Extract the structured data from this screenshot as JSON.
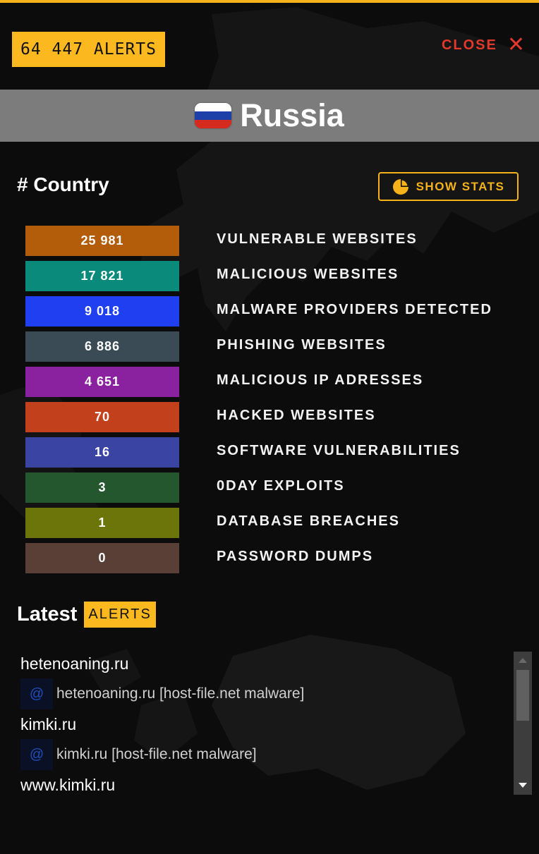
{
  "header": {
    "alerts_count_label": "64 447 ALERTS",
    "close_label": "CLOSE",
    "close_icon": "close-x-icon"
  },
  "country": {
    "name": "Russia",
    "flag_colors": [
      "#ffffff",
      "#1c3fa8",
      "#d52b1e"
    ]
  },
  "section": {
    "title": "# Country",
    "stats_button_label": "SHOW STATS",
    "stats_button_icon": "pie-chart-icon"
  },
  "stats": [
    {
      "value": "25 981",
      "label": "VULNERABLE WEBSITES",
      "color": "#b35c0a"
    },
    {
      "value": "17 821",
      "label": "MALICIOUS WEBSITES",
      "color": "#0a8a7a"
    },
    {
      "value": "9 018",
      "label": "MALWARE PROVIDERS DETECTED",
      "color": "#1f3ff0"
    },
    {
      "value": "6 886",
      "label": "PHISHING WEBSITES",
      "color": "#3a4b55"
    },
    {
      "value": "4 651",
      "label": "MALICIOUS IP ADRESSES",
      "color": "#8a22a0"
    },
    {
      "value": "70",
      "label": "HACKED WEBSITES",
      "color": "#c2401c"
    },
    {
      "value": "16",
      "label": "SOFTWARE VULNERABILITIES",
      "color": "#3a45a3"
    },
    {
      "value": "3",
      "label": "0DAY EXPLOITS",
      "color": "#24572d"
    },
    {
      "value": "1",
      "label": "DATABASE BREACHES",
      "color": "#6b750a"
    },
    {
      "value": "0",
      "label": "PASSWORD DUMPS",
      "color": "#5a3f36"
    }
  ],
  "latest": {
    "title": "Latest",
    "badge": "ALERTS",
    "items": [
      {
        "domain": "hetenoaning.ru",
        "detail": "hetenoaning.ru [host-file.net malware]"
      },
      {
        "domain": "kimki.ru",
        "detail": "kimki.ru [host-file.net malware]"
      },
      {
        "domain": "www.kimki.ru"
      }
    ],
    "detail_icon": "at-sign-icon"
  }
}
